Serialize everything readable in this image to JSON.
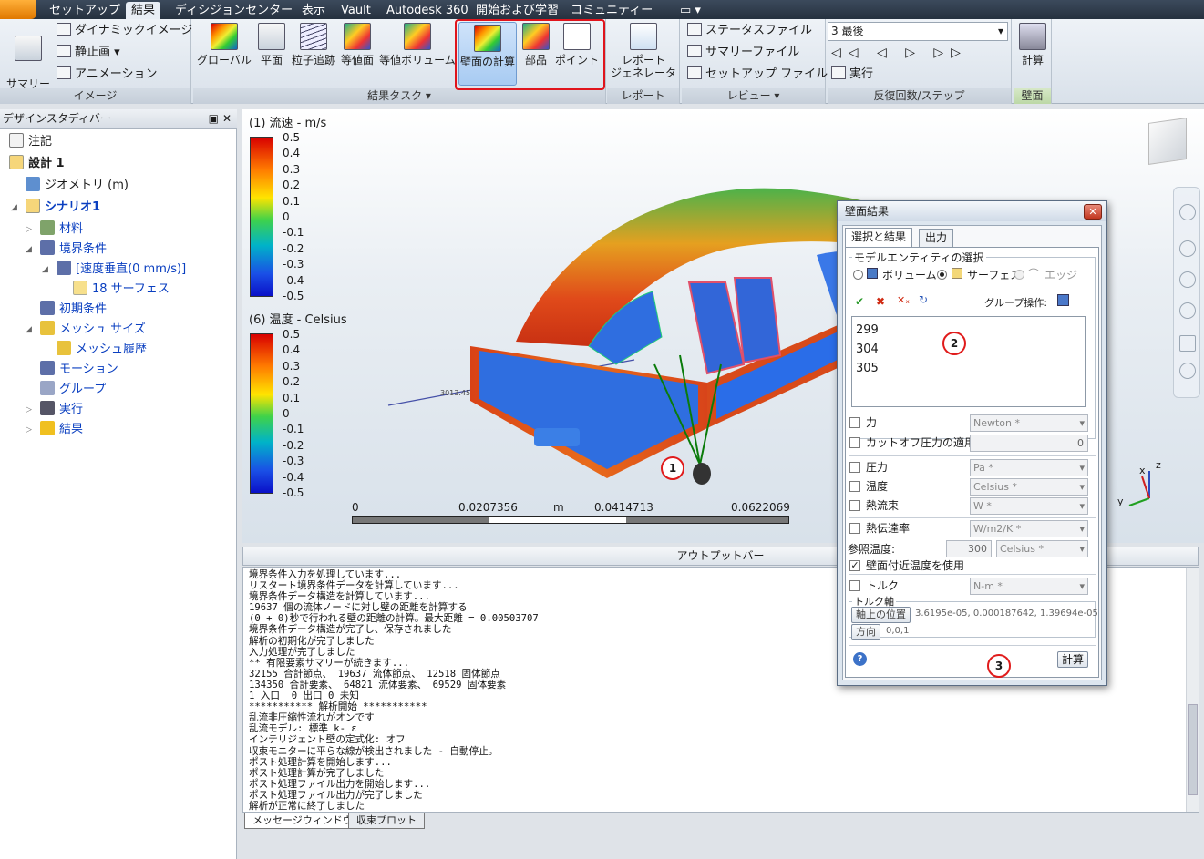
{
  "menubar": {
    "tabs": [
      "セットアップ",
      "結果",
      "ディシジョンセンター",
      "表示",
      "Vault",
      "Autodesk 360",
      "開始および学習",
      "コミュニティー"
    ],
    "active_tab": "結果"
  },
  "ribbon": {
    "image_group": {
      "label": "イメージ",
      "summary_image": "サマリー\nイメージ",
      "dynamic_image": "ダイナミックイメージ",
      "still_image": "静止画",
      "animation": "アニメーション"
    },
    "result_tasks": {
      "label": "結果タスク",
      "buttons": [
        "グローバル",
        "平面",
        "粒子追跡",
        "等値面",
        "等値ボリューム",
        "壁面の計算",
        "部品",
        "ポイント"
      ]
    },
    "report_group": {
      "label": "レポート",
      "generator": "レポート\nジェネレータ"
    },
    "review_group": {
      "label": "レビュー",
      "status_file": "ステータスファイル",
      "summary_file": "サマリーファイル",
      "setup_file": "セットアップ ファイル"
    },
    "iteration_group": {
      "label": "反復回数/ステップ",
      "selector": "3 最後",
      "run": "実行"
    },
    "wall_group": {
      "label": "壁面",
      "calc": "計算"
    }
  },
  "design_study_bar": {
    "title": "デザインスタディバー",
    "items": [
      {
        "label": "注記"
      },
      {
        "label": "設計 1"
      },
      {
        "label": "ジオメトリ (m)"
      },
      {
        "label": "シナリオ1"
      },
      {
        "label": "材料"
      },
      {
        "label": "境界条件"
      },
      {
        "label": "[速度垂直(0 mm/s)]"
      },
      {
        "label": "18 サーフェス"
      },
      {
        "label": "初期条件"
      },
      {
        "label": "メッシュ サイズ"
      },
      {
        "label": "メッシュ履歴"
      },
      {
        "label": "モーション"
      },
      {
        "label": "グループ"
      },
      {
        "label": "実行"
      },
      {
        "label": "結果"
      }
    ]
  },
  "viewport": {
    "legend1_title": "(1) 流速 - m/s",
    "legend2_title": "(6) 温度 - Celsius",
    "legend_values": [
      "0.5",
      "0.4",
      "0.3",
      "0.2",
      "0.1",
      "0",
      "-0.1",
      "-0.2",
      "-0.3",
      "-0.4",
      "-0.5"
    ],
    "scale_labels": [
      "0",
      "0.0207356",
      "m",
      "0.0414713",
      "0.0622069"
    ],
    "probe_label": "3013.45",
    "axes": {
      "x": "x",
      "y": "y",
      "z": "z"
    }
  },
  "output": {
    "title": "アウトプットバー",
    "lines": [
      "境界条件入力を処理しています...",
      "リスタート境界条件データを計算しています...",
      "境界条件データ構造を計算しています...",
      "19637 個の流体ノードに対し壁の距離を計算する",
      "(0 + 0)秒で行われる壁の距離の計算。最大距離 = 0.00503707",
      "境界条件データ構造が完了し、保存されました",
      "解析の初期化が完了しました",
      "入力処理が完了しました",
      "** 有限要素サマリーが続きます...",
      "32155 合計節点、 19637 流体節点、 12518 固体節点",
      "134350 合計要素、 64821 流体要素、 69529 固体要素",
      "1 入口  0 出口 0 未知",
      "*********** 解析開始 ***********",
      "乱流非圧縮性流れがオンです",
      "乱流モデル: 標準 k- ε",
      "インテリジェント壁の定式化: オフ",
      "収束モニターに平らな線が検出されました - 自動停止。",
      "ポスト処理計算を開始します...",
      "ポスト処理計算が完了しました",
      "ポスト処理ファイル出力を開始します...",
      "ポスト処理ファイル出力が完了しました",
      "解析が正常に終了しました"
    ],
    "tabs": [
      "メッセージウィンドウ",
      "収束プロット"
    ]
  },
  "dialog": {
    "title": "壁面結果",
    "tabs": [
      "選択と結果",
      "出力"
    ],
    "entity_group": "モデルエンティティの選択",
    "radio_volume": "ボリューム",
    "radio_surface": "サーフェス",
    "radio_edge": "エッジ",
    "group_ops": "グループ操作:",
    "selected_ids": [
      "299",
      "304",
      "305"
    ],
    "force": {
      "label": "力",
      "unit": "Newton *"
    },
    "cutoff": {
      "label": "カットオフ圧力の適用",
      "value": "0"
    },
    "pressure": {
      "label": "圧力",
      "unit": "Pa *"
    },
    "temperature": {
      "label": "温度",
      "unit": "Celsius *"
    },
    "heat_flux": {
      "label": "熱流束",
      "unit": "W *"
    },
    "htc": {
      "label": "熱伝達率",
      "unit": "W/m2/K *"
    },
    "ref_temp": {
      "label": "参照温度:",
      "value": "300",
      "unit": "Celsius *"
    },
    "near_wall": {
      "label": "壁面付近温度を使用"
    },
    "torque": {
      "label": "トルク",
      "unit": "N-m *"
    },
    "torque_axis": "トルク軸",
    "axis_position": {
      "label": "軸上の位置",
      "value": "3.6195e-05, 0.000187642, 1.39694e-05"
    },
    "direction": {
      "label": "方向",
      "value": "0,0,1"
    },
    "calc_button": "計算"
  },
  "callouts": [
    "1",
    "2",
    "3"
  ]
}
